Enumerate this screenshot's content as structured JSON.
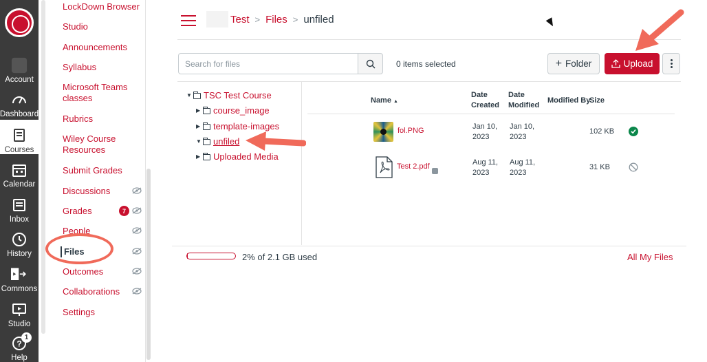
{
  "global_nav": {
    "items": [
      {
        "label": "Account",
        "icon": "account-icon"
      },
      {
        "label": "Dashboard",
        "icon": "dashboard-icon"
      },
      {
        "label": "Courses",
        "icon": "courses-icon",
        "active": true
      },
      {
        "label": "Calendar",
        "icon": "calendar-icon"
      },
      {
        "label": "Inbox",
        "icon": "inbox-icon"
      },
      {
        "label": "History",
        "icon": "history-icon"
      },
      {
        "label": "Commons",
        "icon": "commons-icon"
      },
      {
        "label": "Studio",
        "icon": "studio-icon"
      },
      {
        "label": "Help",
        "icon": "help-icon",
        "badge": "1"
      }
    ]
  },
  "course_nav": {
    "items": [
      {
        "label": "LockDown Browser"
      },
      {
        "label": "Studio"
      },
      {
        "label": "Announcements"
      },
      {
        "label": "Syllabus"
      },
      {
        "label": "Microsoft Teams classes"
      },
      {
        "label": "Rubrics"
      },
      {
        "label": "Wiley Course Resources"
      },
      {
        "label": "Submit Grades"
      },
      {
        "label": "Discussions",
        "hidden": true
      },
      {
        "label": "Grades",
        "hidden": true,
        "badge": "7"
      },
      {
        "label": "People",
        "hidden": true
      },
      {
        "label": "Files",
        "hidden": true,
        "active": true
      },
      {
        "label": "Outcomes",
        "hidden": true
      },
      {
        "label": "Collaborations",
        "hidden": true
      },
      {
        "label": "Settings"
      }
    ]
  },
  "breadcrumb": {
    "items": [
      "Test",
      "Files",
      "unfiled"
    ]
  },
  "toolbar": {
    "search_placeholder": "Search for files",
    "selected_count": "0 items selected",
    "folder_label": "Folder",
    "upload_label": "Upload"
  },
  "tree": {
    "root": "TSC Test Course",
    "children": [
      "course_image",
      "template-images",
      "unfiled",
      "Uploaded Media"
    ],
    "current": "unfiled"
  },
  "table": {
    "headers": {
      "name": "Name",
      "created": "Date Created",
      "modified": "Date Modified",
      "modified_by": "Modified By",
      "size": "Size"
    },
    "rows": [
      {
        "name": "fol.PNG",
        "created_1": "Jan 10,",
        "created_2": "2023",
        "modified_1": "Jan 10,",
        "modified_2": "2023",
        "size": "102 KB",
        "published": true
      },
      {
        "name": "Test 2.pdf",
        "created_1": "Aug 11,",
        "created_2": "2023",
        "modified_1": "Aug 11,",
        "modified_2": "2023",
        "size": "31 KB",
        "published": false
      }
    ]
  },
  "footer": {
    "usage_text": "2% of 2.1 GB used",
    "usage_percent": 2,
    "all_files": "All My Files"
  },
  "colors": {
    "accent": "#c8102e",
    "nav_bg": "#3b3b3b",
    "annotation": "#f06a5a",
    "published": "#0b874b"
  }
}
